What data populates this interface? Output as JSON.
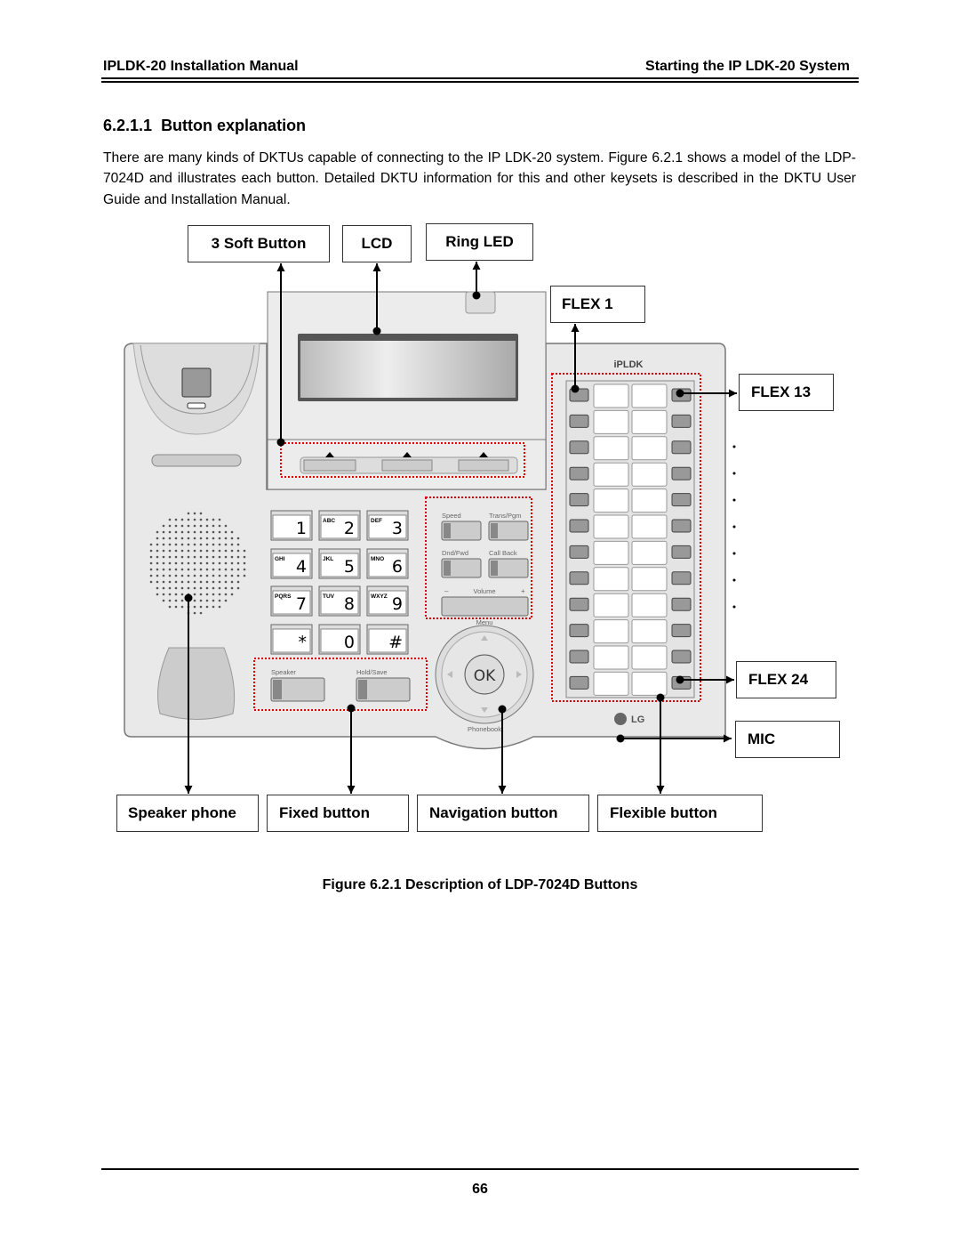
{
  "header": {
    "left": "IPLDK-20 Installation Manual",
    "right": "Starting the IP LDK-20 System"
  },
  "section": {
    "number": "6.2.1.1",
    "title": "Button explanation"
  },
  "paragraph": "There are many kinds of DKTUs capable of connecting to the IP LDK-20 system. Figure 6.2.1 shows a model of the LDP-7024D and illustrates each button. Detailed DKTU information for this and other keysets is described in the DKTU User Guide and Installation Manual.",
  "callouts": {
    "soft": "3 Soft Button",
    "lcd": "LCD",
    "ring": "Ring LED",
    "flex1": "FLEX 1",
    "flex13": "FLEX 13",
    "flex24": "FLEX 24",
    "mic": "MIC",
    "speaker": "Speaker phone",
    "fixed": "Fixed button",
    "nav": "Navigation button",
    "flexible": "Flexible button"
  },
  "phone": {
    "brand_logo": "iPLDK",
    "maker_logo": "LG",
    "keypad": [
      [
        "1",
        ""
      ],
      [
        "2",
        "ABC"
      ],
      [
        "3",
        "DEF"
      ],
      [
        "4",
        "GHI"
      ],
      [
        "5",
        "JKL"
      ],
      [
        "6",
        "MNO"
      ],
      [
        "7",
        "PQRS"
      ],
      [
        "8",
        "TUV"
      ],
      [
        "9",
        "WXYZ"
      ],
      [
        "*",
        ""
      ],
      [
        "0",
        ""
      ],
      [
        "#",
        ""
      ]
    ],
    "feature_keys": [
      "Speed",
      "Trans/Pgm",
      "Dnd/Fwd",
      "Call Back"
    ],
    "volume": {
      "label": "Volume",
      "minus": "–",
      "plus": "+"
    },
    "nav": {
      "ok": "OK",
      "top": "Menu",
      "bottom": "Phonebook"
    },
    "fixed_keys": [
      "Speaker",
      "Hold/Save"
    ],
    "highlight_color": "#e00000"
  },
  "figure_caption": "Figure 6.2.1 Description of LDP-7024D Buttons",
  "page_number": "66"
}
